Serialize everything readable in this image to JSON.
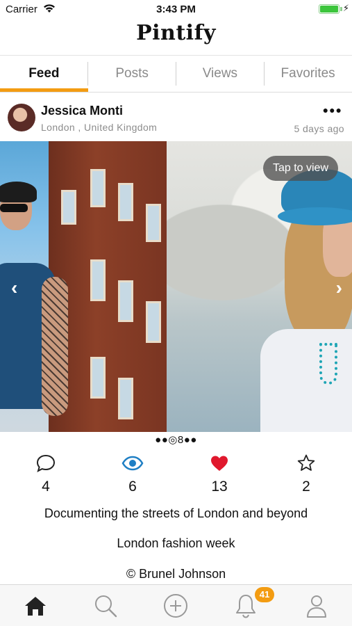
{
  "status_bar": {
    "carrier": "Carrier",
    "time": "3:43 PM",
    "battery_level": 1.0
  },
  "app": {
    "title": "Pintify"
  },
  "tabs": [
    {
      "label": "Feed",
      "active": true
    },
    {
      "label": "Posts",
      "active": false
    },
    {
      "label": "Views",
      "active": false
    },
    {
      "label": "Favorites",
      "active": false
    }
  ],
  "post": {
    "author": "Jessica Monti",
    "location": "London , United Kingdom",
    "date": "5 days ago",
    "more_label": "●●●",
    "tap_to_view": "Tap to view",
    "prev_arrow": "‹",
    "next_arrow": "›",
    "pager": "●●◎8●●",
    "actions": {
      "comments": "4",
      "views": "6",
      "likes": "13",
      "favorites": "2"
    },
    "caption_lines": [
      "Documenting the streets of London and beyond",
      "London fashion week",
      "© Brunel Johnson"
    ]
  },
  "tabbar": {
    "items": [
      "home-icon",
      "search-icon",
      "add-icon",
      "notifications-icon",
      "profile-icon"
    ],
    "notification_badge": "41"
  },
  "colors": {
    "accent": "#f39c12",
    "views_blue": "#1f7fc4",
    "like_red": "#e0182d"
  }
}
